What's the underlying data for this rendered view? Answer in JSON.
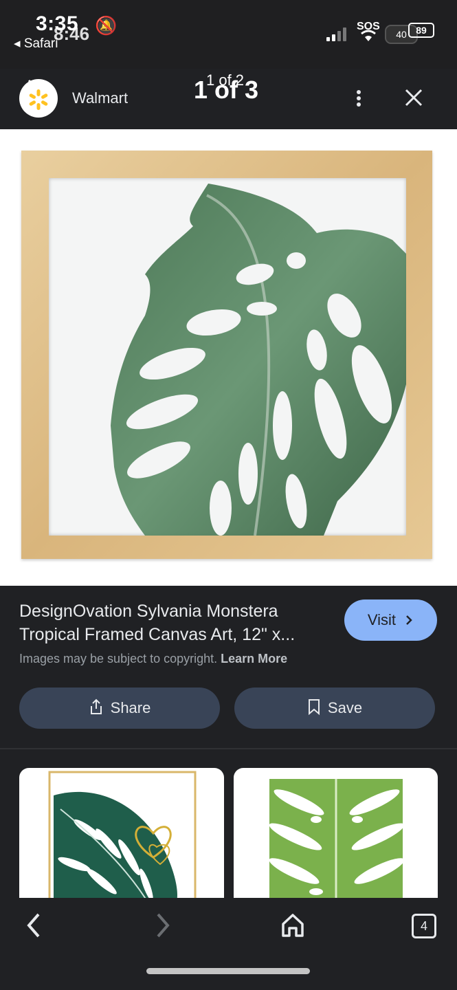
{
  "status_bar": {
    "time": "3:35",
    "time_overlay": "8:46",
    "back_app": "◂ Safari",
    "sos": "SOS",
    "battery": "89",
    "battery_overlay": "40"
  },
  "header": {
    "site_name": "Walmart",
    "counter": "1 of 3",
    "counter_overlay": "1 of 2"
  },
  "result": {
    "title_line1": "DesignOvation Sylvania Monstera",
    "title_line2": "Tropical Framed Canvas Art, 12\" x...",
    "visit_label": "Visit",
    "copyright_text": "Images may be subject to copyright.",
    "learn_more": "Learn More",
    "share_label": "Share",
    "save_label": "Save"
  },
  "bottom_nav": {
    "tab_count": "4"
  },
  "colors": {
    "background": "#202124",
    "visit_button": "#8ab4f8",
    "action_button": "#394457",
    "frame_wood": "#dcbc85"
  },
  "icons": [
    "walmart-spark-icon",
    "more-vert-icon",
    "close-icon",
    "share-icon",
    "bookmark-icon",
    "back-arrow-icon",
    "forward-arrow-icon",
    "home-icon",
    "tabs-icon"
  ]
}
